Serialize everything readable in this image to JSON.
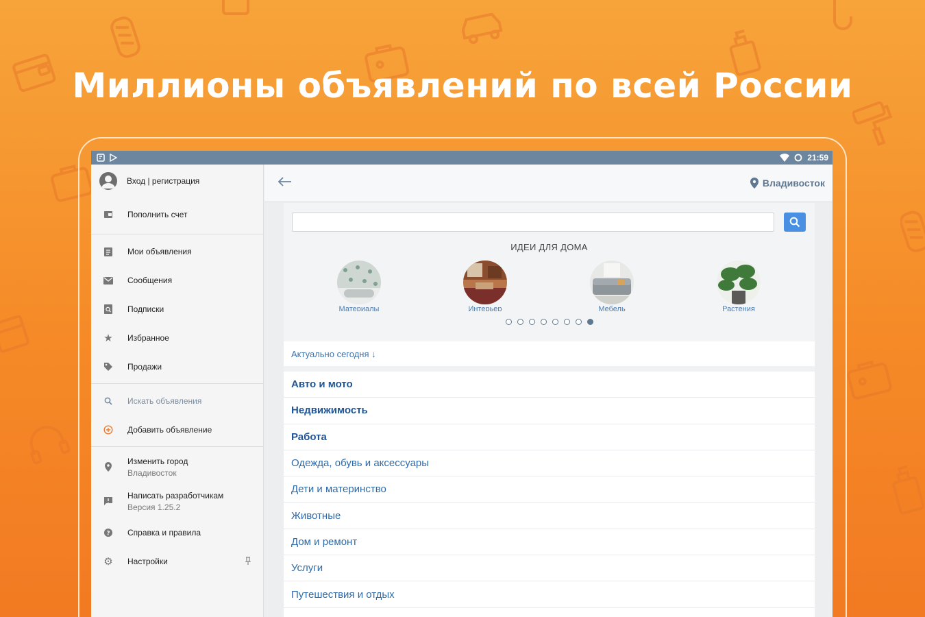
{
  "headline": "Миллионы объявлений по всей России",
  "status_bar": {
    "time": "21:59"
  },
  "drawer": {
    "login": "Вход | регистрация",
    "topup": "Пополнить счет",
    "my_ads": "Мои объявления",
    "messages": "Сообщения",
    "subscriptions": "Подписки",
    "favorites": "Избранное",
    "sales": "Продажи",
    "search_ads": "Искать объявления",
    "add_ad": "Добавить объявление",
    "change_city": "Изменить город",
    "change_city_sub": "Владивосток",
    "write_dev": "Написать разработчикам",
    "write_dev_sub": "Версия 1.25.2",
    "help": "Справка и правила",
    "settings": "Настройки"
  },
  "topbar": {
    "city": "Владивосток"
  },
  "search": {
    "placeholder": ""
  },
  "ideas": {
    "title": "ИДЕИ ДЛЯ ДОМА",
    "items": [
      {
        "label": "Материалы"
      },
      {
        "label": "Интерьер"
      },
      {
        "label": "Мебель"
      },
      {
        "label": "Растения"
      }
    ],
    "pages": 8,
    "active_page": 8
  },
  "actual_today": "Актуально сегодня ↓",
  "categories": [
    {
      "label": "Авто и мото",
      "bold": true
    },
    {
      "label": "Недвижимость",
      "bold": true
    },
    {
      "label": "Работа",
      "bold": true
    },
    {
      "label": "Одежда, обувь и аксессуары",
      "bold": false
    },
    {
      "label": "Дети и материнство",
      "bold": false
    },
    {
      "label": "Животные",
      "bold": false
    },
    {
      "label": "Дом и ремонт",
      "bold": false
    },
    {
      "label": "Услуги",
      "bold": false
    },
    {
      "label": "Путешествия и отдых",
      "bold": false
    }
  ],
  "colors": {
    "background": "#F58A27",
    "status_bar": "#6D86A0",
    "accent_blue": "#4A90E2",
    "link_blue": "#2F6AA8"
  }
}
